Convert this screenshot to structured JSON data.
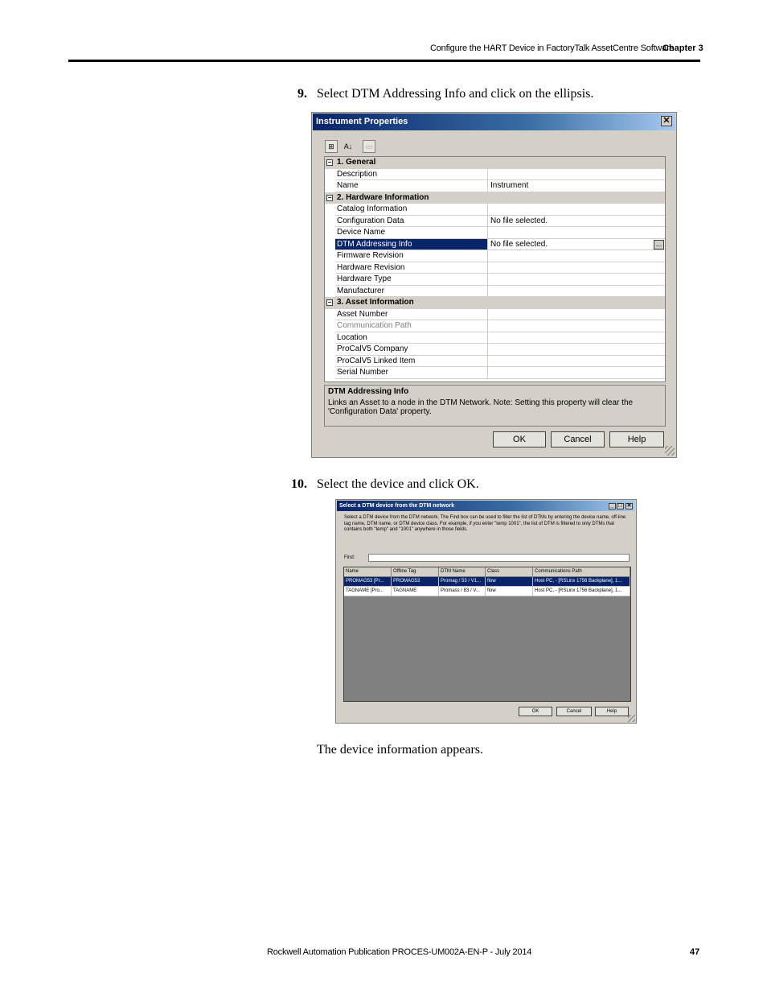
{
  "header": {
    "section_title": "Configure the HART Device in FactoryTalk AssetCentre Software",
    "chapter": "Chapter 3"
  },
  "steps": [
    {
      "number": "9.",
      "text": "Select DTM Addressing Info and click on the ellipsis."
    },
    {
      "number": "10.",
      "text": "Select the device and click OK."
    }
  ],
  "result_text": "The device information appears.",
  "dialog1": {
    "title": "Instrument Properties",
    "close_glyph": "✕",
    "rows": [
      {
        "type": "category",
        "label": "1. General",
        "expand": "⊟"
      },
      {
        "type": "prop",
        "label": "Description",
        "value": ""
      },
      {
        "type": "prop",
        "label": "Name",
        "value": "Instrument"
      },
      {
        "type": "category",
        "label": "2. Hardware Information",
        "expand": "⊟"
      },
      {
        "type": "prop",
        "label": "Catalog Information",
        "value": ""
      },
      {
        "type": "prop",
        "label": "Configuration Data",
        "value": "No file selected."
      },
      {
        "type": "prop",
        "label": "Device Name",
        "value": ""
      },
      {
        "type": "prop",
        "label": "DTM Addressing Info",
        "value": "No file selected.",
        "selected": true,
        "ellipsis": "..."
      },
      {
        "type": "prop",
        "label": "Firmware Revision",
        "value": ""
      },
      {
        "type": "prop",
        "label": "Hardware Revision",
        "value": ""
      },
      {
        "type": "prop",
        "label": "Hardware Type",
        "value": ""
      },
      {
        "type": "prop",
        "label": "Manufacturer",
        "value": ""
      },
      {
        "type": "category",
        "label": "3. Asset Information",
        "expand": "⊟"
      },
      {
        "type": "prop",
        "label": "Asset Number",
        "value": ""
      },
      {
        "type": "prop",
        "label": "Communication Path",
        "value": "",
        "disabled": true
      },
      {
        "type": "prop",
        "label": "Location",
        "value": ""
      },
      {
        "type": "prop",
        "label": "ProCalV5 Company",
        "value": ""
      },
      {
        "type": "prop",
        "label": "ProCalV5 Linked Item",
        "value": ""
      },
      {
        "type": "prop",
        "label": "Serial Number",
        "value": ""
      }
    ],
    "description_title": "DTM Addressing Info",
    "description_text": "Links an Asset to a node in the DTM Network.  Note: Setting this property will clear the 'Configuration Data' property.",
    "ok_label": "OK",
    "cancel_label": "Cancel",
    "help_label": "Help"
  },
  "dialog2": {
    "title": "Select a DTM device from the DTM network",
    "min_glyph": "_",
    "max_glyph": "□",
    "close_glyph": "✕",
    "instructions": "Select a DTM device from the DTM network.  The Find box can be used to filter the list of DTMs by entering the device name, off-line tag name, DTM name, or DTM device class. For example, if you enter \"temp 1001\", the list of DTM is filtered to only DTMs that contains both \"temp\" and \"1001\" anywhere in those fields.",
    "find_label": "Find:",
    "find_value": "",
    "columns": [
      "Name",
      "Offline Tag",
      "DTM Name",
      "Class",
      "Communications Path"
    ],
    "rows": [
      {
        "cells": [
          "PROMAG53  [Pr...",
          "PROMAG53",
          "Promag / 53 / V1...",
          "flow",
          "Host PC, - [RSLinx 1756 Backplane], 1..."
        ],
        "selected": true
      },
      {
        "cells": [
          "TAGNAME  [Pro...",
          "TAGNAME",
          "Promass / 83 / V...",
          "flow",
          "Host PC, - [RSLinx 1756 Backplane], 1..."
        ],
        "selected": false
      }
    ],
    "ok_label": "OK",
    "cancel_label": "Cancel",
    "help_label": "Help"
  },
  "footer": {
    "publication": "Rockwell Automation Publication PROCES-UM002A-EN-P - July 2014",
    "page_number": "47"
  }
}
